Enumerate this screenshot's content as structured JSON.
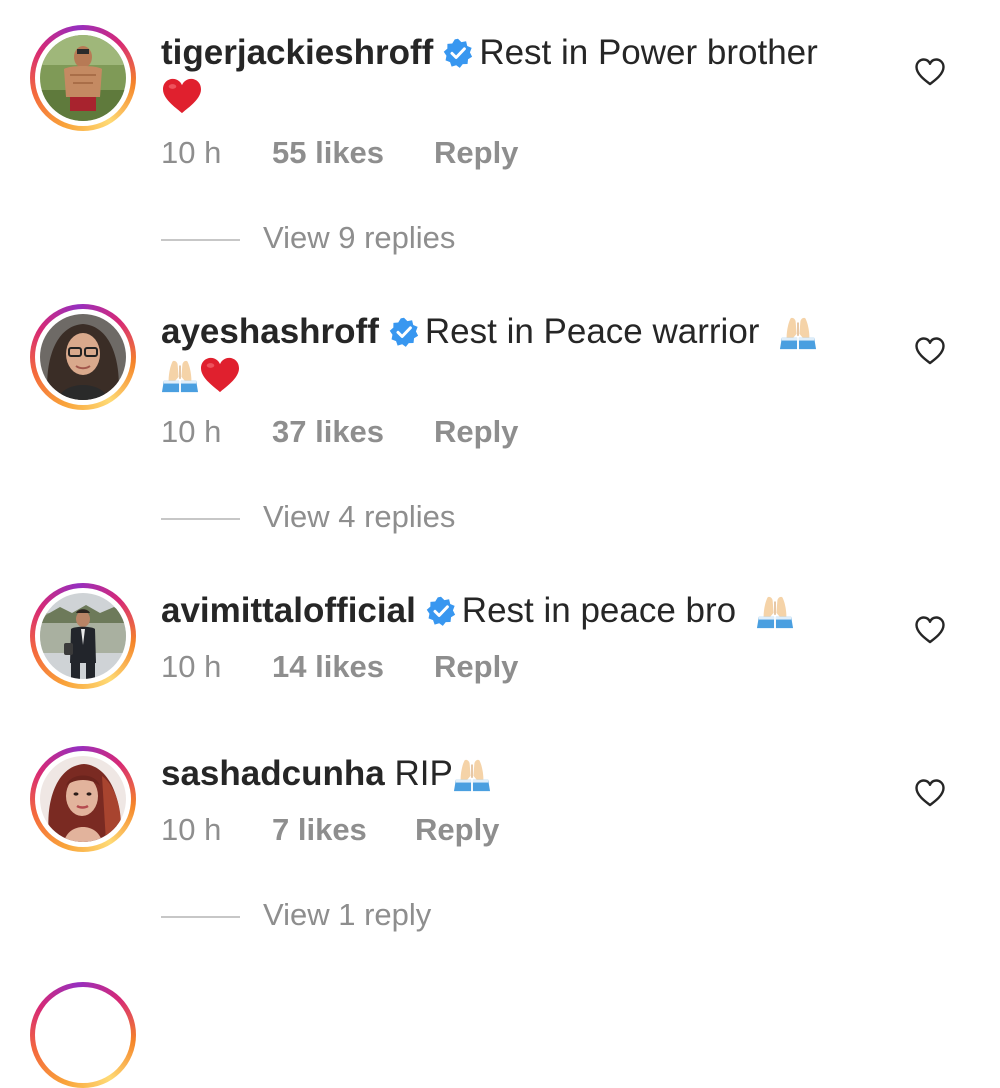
{
  "comments": [
    {
      "username": "tigerjackieshroff",
      "verified": true,
      "text": "Rest in Power brother",
      "time": "10 h",
      "likes": "55 likes",
      "reply": "Reply",
      "view_replies": "View 9 replies"
    },
    {
      "username": "ayeshashroff",
      "verified": true,
      "text": "Rest in Peace warrior",
      "time": "10 h",
      "likes": "37 likes",
      "reply": "Reply",
      "view_replies": "View 4 replies"
    },
    {
      "username": "avimittalofficial",
      "verified": true,
      "text": "Rest in peace bro",
      "time": "10 h",
      "likes": "14 likes",
      "reply": "Reply"
    },
    {
      "username": "sashadcunha",
      "verified": false,
      "text": "RIP",
      "time": "10 h",
      "likes": "7 likes",
      "reply": "Reply",
      "view_replies": "View 1 reply"
    }
  ],
  "icons": {
    "like": "heart-outline-icon",
    "verified": "verified-badge-icon",
    "emoji_heart": "red-heart-emoji",
    "emoji_pray": "folded-hands-emoji"
  },
  "colors": {
    "verified_blue": "#3897f0",
    "muted_text": "#8e8e8e",
    "heart_red": "#e0202e"
  }
}
